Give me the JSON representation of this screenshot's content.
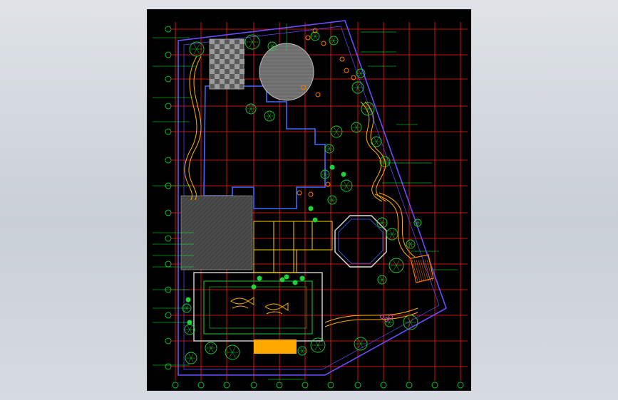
{
  "window": {
    "background_start": "#dfe3e8",
    "background_end": "#c9cfd6"
  },
  "drawing": {
    "background": "#000000",
    "grid_color": "#ff1a1a",
    "boundary_color": "#6b4cff",
    "plant_color": "#1fd13a",
    "paving_color": "#b0b0b0",
    "accent_color": "#ffb000",
    "label_color": "#00ff33",
    "title_text": "",
    "scale_text": "",
    "annotations_left": [
      "",
      "",
      "",
      "",
      "",
      "",
      "",
      "",
      "",
      "",
      "",
      "",
      "",
      "",
      ""
    ],
    "annotations_right": [
      "",
      "",
      "",
      "",
      "",
      "",
      "",
      "",
      ""
    ],
    "annotations_top": [
      ""
    ],
    "annotations_bottom": [
      "",
      "",
      ""
    ]
  }
}
